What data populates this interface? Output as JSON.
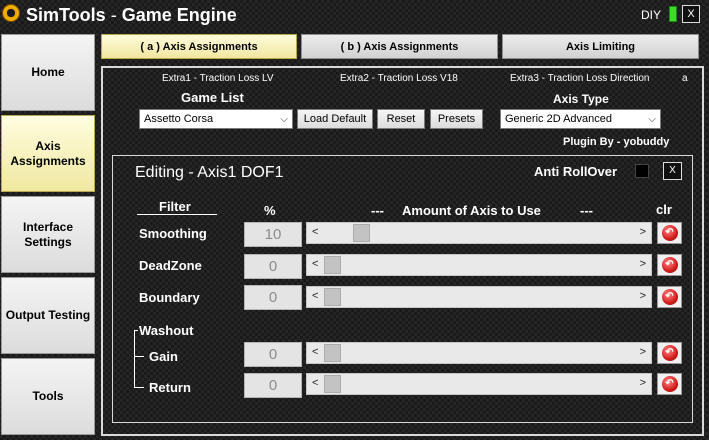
{
  "title": {
    "brand": "SimTools",
    "separator": "-",
    "product": "Game Engine"
  },
  "window": {
    "mode_label": "DIY",
    "close_glyph": "X"
  },
  "sidebar": {
    "items": [
      {
        "label": "Home"
      },
      {
        "label": "Axis Assignments",
        "active": true
      },
      {
        "label": "Interface Settings"
      },
      {
        "label": "Output Testing"
      },
      {
        "label": "Tools"
      }
    ]
  },
  "tabs": [
    {
      "label": "( a ) Axis Assignments",
      "active": true
    },
    {
      "label": "( b ) Axis Assignments"
    },
    {
      "label": "Axis Limiting"
    }
  ],
  "extras": [
    "Extra1 - Traction Loss LV",
    "Extra2 - Traction Loss V18",
    "Extra3 - Traction Loss Direction",
    "a"
  ],
  "game_list": {
    "label": "Game List",
    "value": "Assetto Corsa"
  },
  "buttons": {
    "load_default": "Load Default",
    "reset": "Reset",
    "presets": "Presets"
  },
  "axis_type": {
    "label": "Axis Type",
    "value": "Generic 2D Advanced"
  },
  "plugin_by": "Plugin By - yobuddy",
  "editor": {
    "title": "Editing - Axis1 DOF1",
    "anti_rollover": "Anti RollOver",
    "close_glyph": "X",
    "header_filter": "Filter",
    "header_percent": "%",
    "header_amount_left": "---",
    "header_amount": "Amount of Axis to Use",
    "header_amount_right": "---",
    "header_clr": "clr",
    "washout": "Washout",
    "rows": [
      {
        "label": "Smoothing",
        "value": "10",
        "level": 0.1
      },
      {
        "label": "DeadZone",
        "value": "0",
        "level": 0
      },
      {
        "label": "Boundary",
        "value": "0",
        "level": 0
      },
      {
        "label": "Gain",
        "value": "0",
        "level": 0
      },
      {
        "label": "Return",
        "value": "0",
        "level": 0
      }
    ]
  },
  "colors": {
    "accent_tab": "#f1e7a0",
    "indicator": "#3ddc2a",
    "reset_icon": "#d21b1b"
  },
  "icons": {
    "logo": "gear-logo-icon",
    "reset": "undo-arrow-icon",
    "dropdown": "chevron-down-icon"
  }
}
